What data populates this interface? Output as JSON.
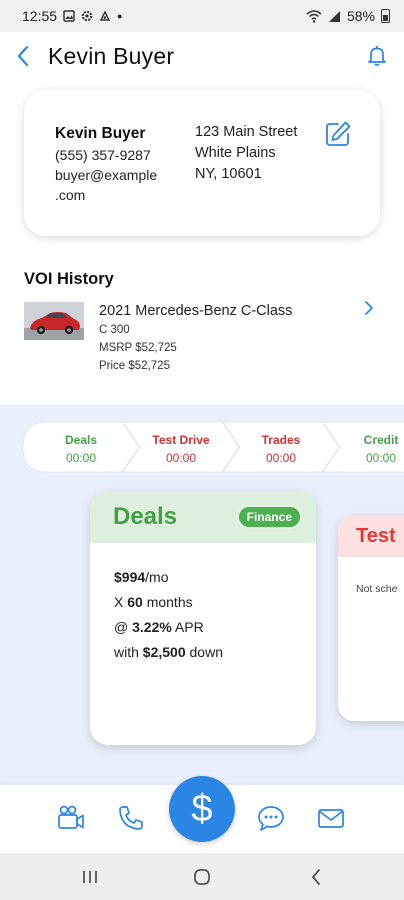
{
  "status_bar": {
    "time": "12:55",
    "battery": "58%"
  },
  "header": {
    "title": "Kevin Buyer"
  },
  "contact": {
    "name": "Kevin Buyer",
    "phone": "(555) 357-9287",
    "email_line1": "buyer@example",
    "email_line2": ".com",
    "address_line1": "123 Main Street",
    "address_line2": "White Plains",
    "address_line3": "NY, 10601"
  },
  "voi": {
    "title": "VOI History",
    "vehicle": {
      "model": "2021 Mercedes-Benz C-Class",
      "trim": "C 300",
      "msrp": "MSRP $52,725",
      "price": "Price $52,725"
    }
  },
  "stages": [
    {
      "label": "Deals",
      "time": "00:00",
      "color": "#43a047"
    },
    {
      "label": "Test Drive",
      "time": "00:00",
      "color": "#d32f2f"
    },
    {
      "label": "Trades",
      "time": "00:00",
      "color": "#d32f2f"
    },
    {
      "label": "Credit",
      "time": "00:00",
      "color": "#43a047"
    }
  ],
  "deals_card": {
    "title": "Deals",
    "badge": "Finance",
    "payment": "$994",
    "payment_unit": "/mo",
    "term_prefix": "X ",
    "term": "60",
    "term_suffix": " months",
    "apr_prefix": "@ ",
    "apr": "3.22%",
    "apr_suffix": " APR",
    "down_prefix": "with ",
    "down": "$2,500",
    "down_suffix": " down"
  },
  "test_card": {
    "title": "Test",
    "status": "Not sche"
  },
  "actions": {
    "fab_symbol": "$",
    "icons": [
      "video-icon",
      "phone-icon",
      "chat-icon",
      "mail-icon"
    ]
  },
  "colors": {
    "accent": "#2b85e4",
    "green": "#43a047",
    "red": "#d32f2f",
    "deal_area_bg": "#eaf0fb"
  }
}
